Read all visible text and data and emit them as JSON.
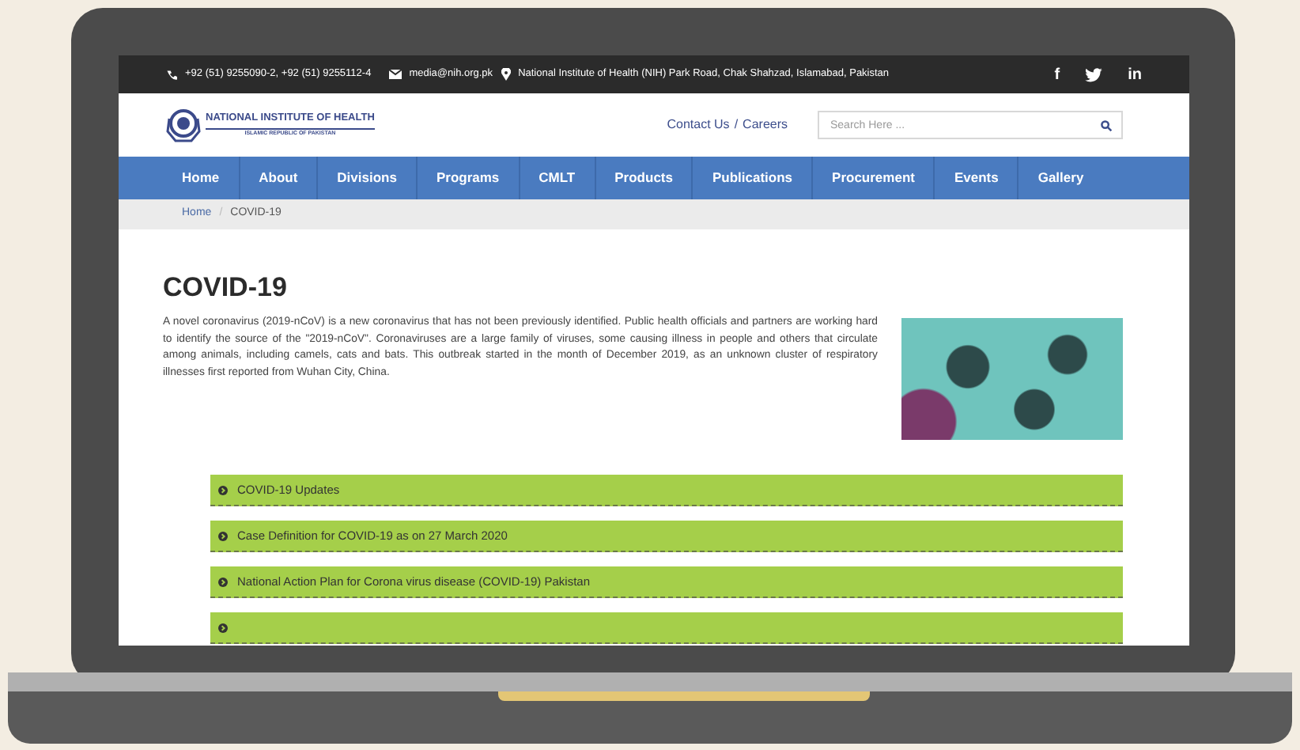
{
  "top_bar": {
    "phone": "+92 (51) 9255090-2, +92 (51) 9255112-4",
    "email": "media@nih.org.pk",
    "address": "National Institute of Health (NIH) Park Road, Chak Shahzad, Islamabad, Pakistan"
  },
  "social": [
    {
      "kind": "text",
      "label": "f"
    },
    {
      "kind": "bird"
    },
    {
      "kind": "text",
      "label": "in"
    }
  ],
  "header": {
    "logo_title": "NATIONAL INSTITUTE OF HEALTH",
    "logo_subtitle": "ISLAMIC REPUBLIC OF PAKISTAN",
    "links": [
      "Contact Us",
      "Careers"
    ],
    "link_separator": "/",
    "search": {
      "placeholder": "Search Here ..."
    }
  },
  "nav": [
    "Home",
    "About",
    "Divisions",
    "Programs",
    "CMLT",
    "Products",
    "Publications",
    "Procurement",
    "Events",
    "Gallery"
  ],
  "breadcrumb": {
    "items": [
      "Home",
      "COVID-19"
    ],
    "separator": "/"
  },
  "article": {
    "title": "COVID-19",
    "body": "A novel coronavirus (2019-nCoV) is a new coronavirus that has not been previously identified. Public health officials and partners are working hard to identify the source of the \"2019-nCoV\". Coronaviruses are a large family of viruses, some causing illness in people and others that circulate among animals, including camels, cats and bats. This outbreak started in the month of December 2019, as an unknown cluster of respiratory illnesses first reported from Wuhan City, China."
  },
  "accordion": [
    {
      "kind": "full",
      "label": "COVID-19 Updates"
    },
    {
      "kind": "full",
      "label": "Case Definition for COVID-19 as on 27 March 2020"
    },
    {
      "kind": "full",
      "label": "National Action Plan for Corona virus disease (COVID-19) Pakistan"
    },
    {
      "kind": "cut_off"
    }
  ]
}
